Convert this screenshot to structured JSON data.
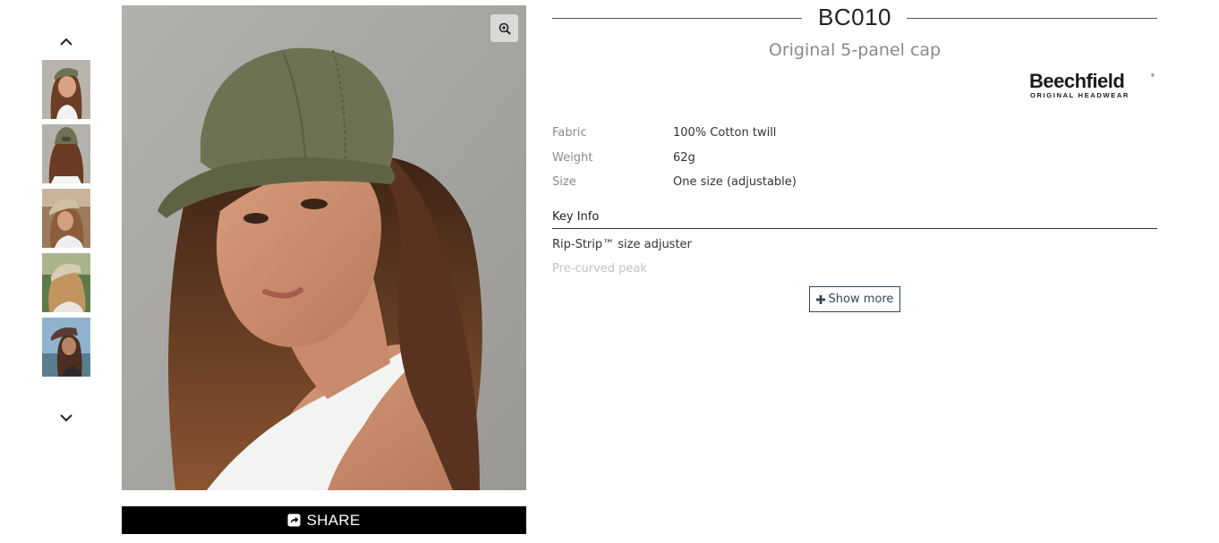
{
  "product": {
    "code": "BC010",
    "name": "Original 5-panel cap"
  },
  "brand": {
    "name": "Beechfield",
    "tagline": "ORIGINAL HEADWEAR"
  },
  "specs": [
    {
      "label": "Fabric",
      "value": "100% Cotton twill"
    },
    {
      "label": "Weight",
      "value": "62g"
    },
    {
      "label": "Size",
      "value": "One size (adjustable)"
    }
  ],
  "key_info": {
    "title": "Key Info",
    "items": [
      "Rip-Strip™ size adjuster",
      "Pre-curved peak"
    ],
    "show_more_label": "Show more"
  },
  "gallery": {
    "thumbnail_count": 5,
    "share_label": "SHARE",
    "icons": {
      "up": "chevron-up-icon",
      "down": "chevron-down-icon",
      "zoom": "zoom-in-icon",
      "share": "share-icon",
      "plus": "plus-icon"
    }
  },
  "colors": {
    "cap_olive": "#6e7253",
    "share_bg": "#000000",
    "show_more_border": "#2e4a5a",
    "muted_text": "#8a8a8a"
  }
}
